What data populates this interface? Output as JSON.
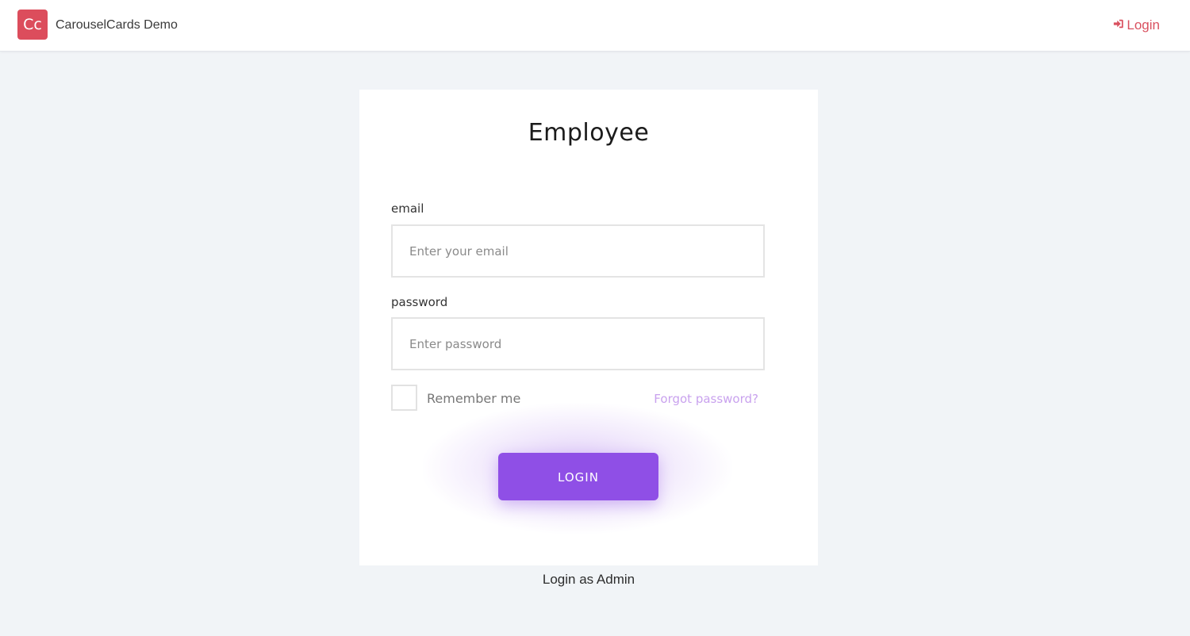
{
  "navbar": {
    "logo_text": "Cc",
    "brand_name": "CarouselCards Demo",
    "login_label": "Login",
    "login_icon": "sign-in-icon",
    "accent_color": "#dc4d5c"
  },
  "form": {
    "title": "Employee",
    "email_label": "email",
    "email_placeholder": "Enter your email",
    "email_value": "",
    "password_label": "password",
    "password_placeholder": "Enter password",
    "password_value": "",
    "remember_label": "Remember me",
    "remember_checked": false,
    "forgot_label": "Forgot password?",
    "submit_label": "LOGIN",
    "submit_color": "#8f4fe6"
  },
  "footer": {
    "admin_link": "Login as Admin"
  }
}
